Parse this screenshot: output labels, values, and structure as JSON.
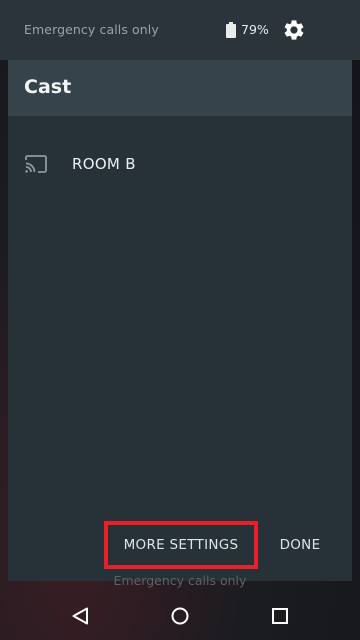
{
  "status_bar": {
    "carrier_text": "Emergency calls only",
    "battery_percent": "79%",
    "battery_icon": "battery-icon",
    "settings_icon": "gear-icon"
  },
  "cast_dialog": {
    "title": "Cast",
    "devices": [
      {
        "label": "ROOM B",
        "icon": "cast-icon"
      }
    ],
    "more_settings_label": "MORE SETTINGS",
    "done_label": "DONE",
    "highlight_color": "#e8202c"
  },
  "background": {
    "lockscreen_text": "Emergency calls only"
  },
  "nav_bar": {
    "back_icon": "back-icon",
    "home_icon": "home-icon",
    "recents_icon": "recents-icon"
  }
}
